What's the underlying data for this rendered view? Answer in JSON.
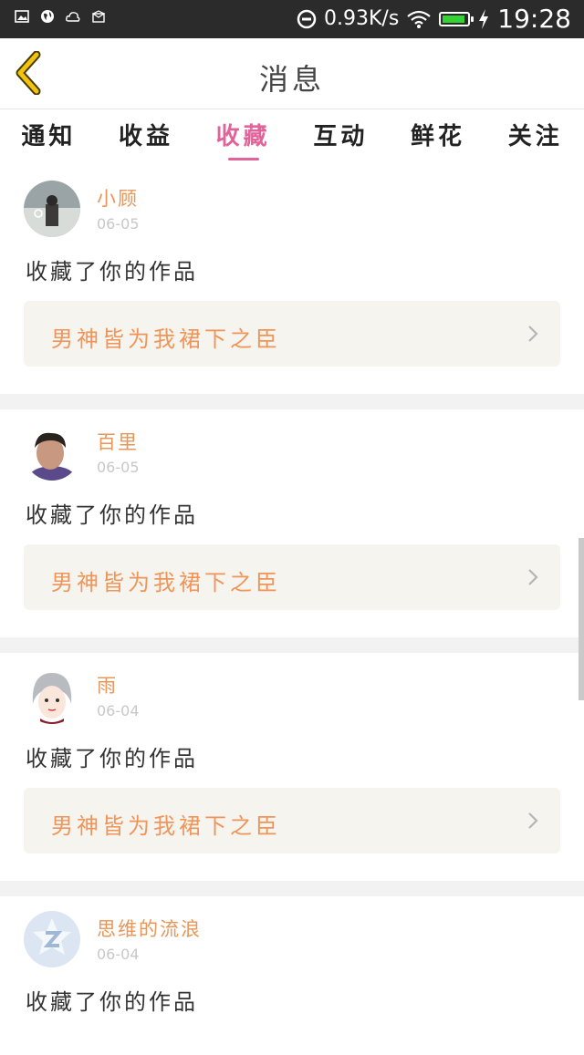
{
  "status_bar": {
    "icons": [
      "gallery-icon",
      "globe-icon",
      "cloud-icon",
      "mail-icon"
    ],
    "net_speed": "0.93K/s",
    "time": "19:28",
    "battery_level": 0.9,
    "battery_color": "#35d235"
  },
  "header": {
    "title": "消息",
    "back_icon": "chevron-left-icon",
    "back_color": "#e0b400"
  },
  "tabs": [
    {
      "label": "通知",
      "active": false
    },
    {
      "label": "收益",
      "active": false
    },
    {
      "label": "收藏",
      "active": true
    },
    {
      "label": "互动",
      "active": false
    },
    {
      "label": "鲜花",
      "active": false
    },
    {
      "label": "关注",
      "active": false
    }
  ],
  "accent_color": "#e0639a",
  "items": [
    {
      "name": "小顾",
      "date": "06-05",
      "action": "收藏了你的作品",
      "work": "男神皆为我裙下之臣"
    },
    {
      "name": "百里",
      "date": "06-05",
      "action": "收藏了你的作品",
      "work": "男神皆为我裙下之臣"
    },
    {
      "name": "雨",
      "date": "06-04",
      "action": "收藏了你的作品",
      "work": "男神皆为我裙下之臣"
    },
    {
      "name": "思维的流浪",
      "date": "06-04",
      "action": "收藏了你的作品"
    }
  ]
}
